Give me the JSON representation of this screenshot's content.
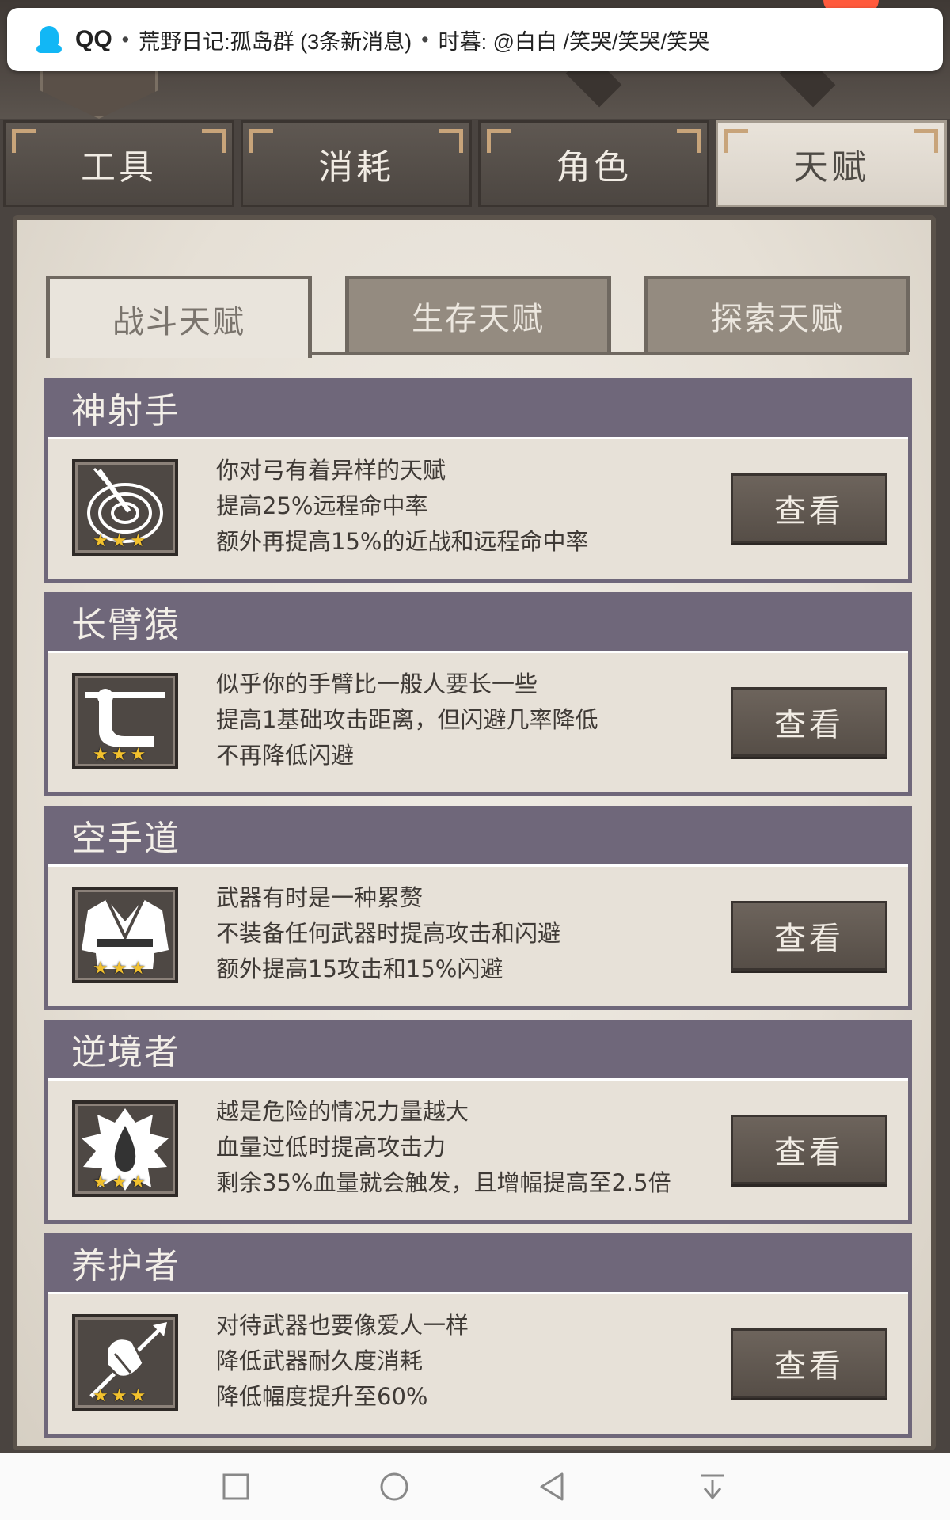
{
  "notification": {
    "app_name": "QQ",
    "separator": "•",
    "group": "荒野日记:孤岛群 (3条新消息)",
    "message": "时暮: @白白 /笑哭/笑哭/笑哭",
    "brand_color": "#12b7f5"
  },
  "tabs": [
    {
      "label": "工具",
      "active": false
    },
    {
      "label": "消耗",
      "active": false
    },
    {
      "label": "角色",
      "active": false
    },
    {
      "label": "天赋",
      "active": true
    }
  ],
  "subtabs": [
    {
      "label": "战斗天赋",
      "active": true
    },
    {
      "label": "生存天赋",
      "active": false
    },
    {
      "label": "探索天赋",
      "active": false
    }
  ],
  "talents": [
    {
      "name": "神射手",
      "icon": "target-arrow-icon",
      "stars": "★★★",
      "lines": [
        "你对弓有着异样的天赋",
        "提高25%远程命中率",
        "额外再提高15%的近战和远程命中率"
      ],
      "button": "查看"
    },
    {
      "name": "长臂猿",
      "icon": "long-arm-icon",
      "stars": "★★★",
      "lines": [
        "似乎你的手臂比一般人要长一些",
        "提高1基础攻击距离，但闪避几率降低",
        "不再降低闪避"
      ],
      "button": "查看"
    },
    {
      "name": "空手道",
      "icon": "karate-gi-icon",
      "stars": "★★★",
      "lines": [
        "武器有时是一种累赘",
        "不装备任何武器时提高攻击和闪避",
        "额外提高15攻击和15%闪避"
      ],
      "button": "查看"
    },
    {
      "name": "逆境者",
      "icon": "blood-drop-icon",
      "stars": "★★★",
      "lines": [
        "越是危险的情况力量越大",
        "血量过低时提高攻击力",
        "剩余35%血量就会触发，且增幅提高至2.5倍"
      ],
      "button": "查看"
    },
    {
      "name": "养护者",
      "icon": "weapon-care-icon",
      "stars": "★★★",
      "lines": [
        "对待武器也要像爱人一样",
        "降低武器耐久度消耗",
        "降低幅度提升至60%"
      ],
      "button": "查看"
    }
  ],
  "navbar": {
    "icons": [
      "recent-apps-icon",
      "home-icon",
      "back-icon",
      "notification-pull-icon"
    ]
  },
  "colors": {
    "title_bar": "#6f677a",
    "parchment": "#e7e1d8",
    "button": "#5f564f",
    "star": "#f2c12e"
  }
}
